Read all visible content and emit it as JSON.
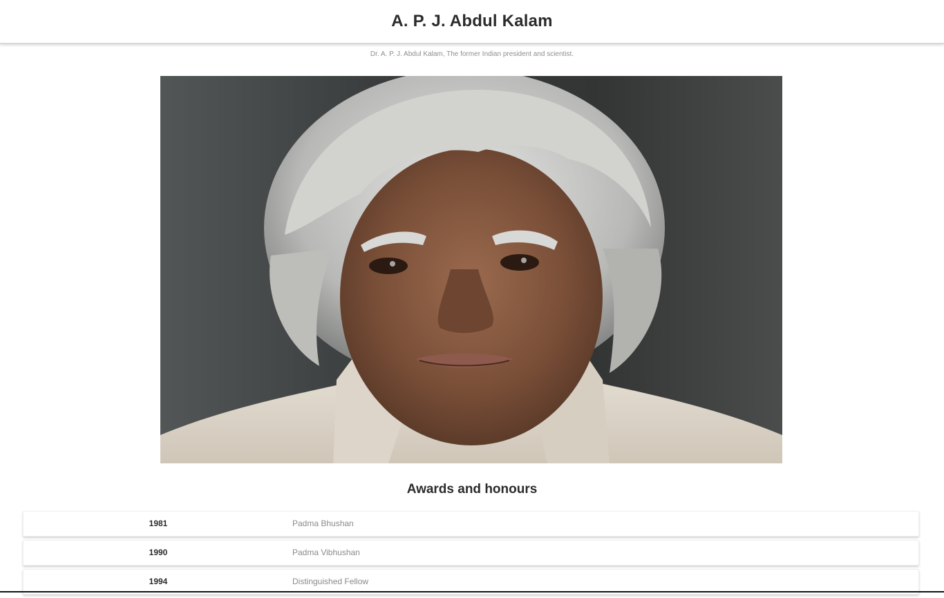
{
  "header": {
    "title": "A. P. J. Abdul Kalam"
  },
  "caption": "Dr. A. P. J. Abdul Kalam, The former Indian president and scientist.",
  "photo": {
    "alt": "Portrait of A. P. J. Abdul Kalam"
  },
  "awards": {
    "title": "Awards and honours",
    "rows": [
      {
        "year": "1981",
        "name": "Padma Bhushan"
      },
      {
        "year": "1990",
        "name": "Padma Vibhushan"
      },
      {
        "year": "1994",
        "name": "Distinguished Fellow"
      }
    ]
  }
}
